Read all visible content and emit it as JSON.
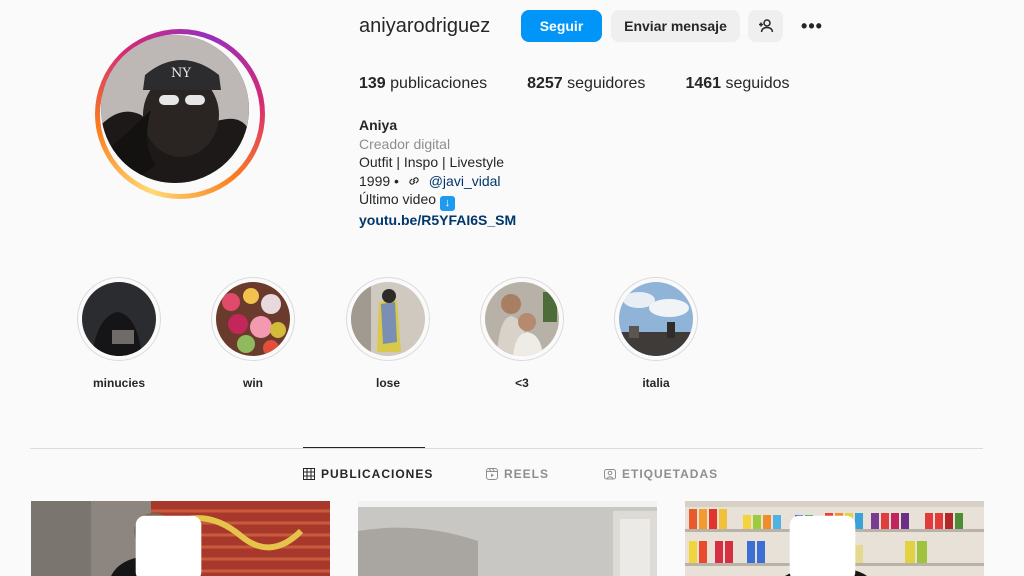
{
  "profile": {
    "username": "aniyarodriguez",
    "follow_label": "Seguir",
    "message_label": "Enviar mensaje",
    "more_label": "•••"
  },
  "stats": {
    "posts_count": "139",
    "posts_label": "publicaciones",
    "followers_count": "8257",
    "followers_label": "seguidores",
    "following_count": "1461",
    "following_label": "seguidos"
  },
  "bio": {
    "name": "Aniya",
    "category": "Creador digital",
    "line1": "Outfit | Inspo | Livestyle",
    "year": "1999 •",
    "mention": "@javi_vidal",
    "video_text": "Último video",
    "link": "youtu.be/R5YFAI6S_SM"
  },
  "highlights": [
    {
      "label": "minucies"
    },
    {
      "label": "win"
    },
    {
      "label": "lose"
    },
    {
      "label": "<3"
    },
    {
      "label": "italia"
    }
  ],
  "tabs": {
    "posts": "PUBLICACIONES",
    "reels": "REELS",
    "tagged": "ETIQUETADAS"
  },
  "colors": {
    "accent": "#0095f6",
    "link": "#00376b",
    "muted": "#8e8e8e"
  }
}
